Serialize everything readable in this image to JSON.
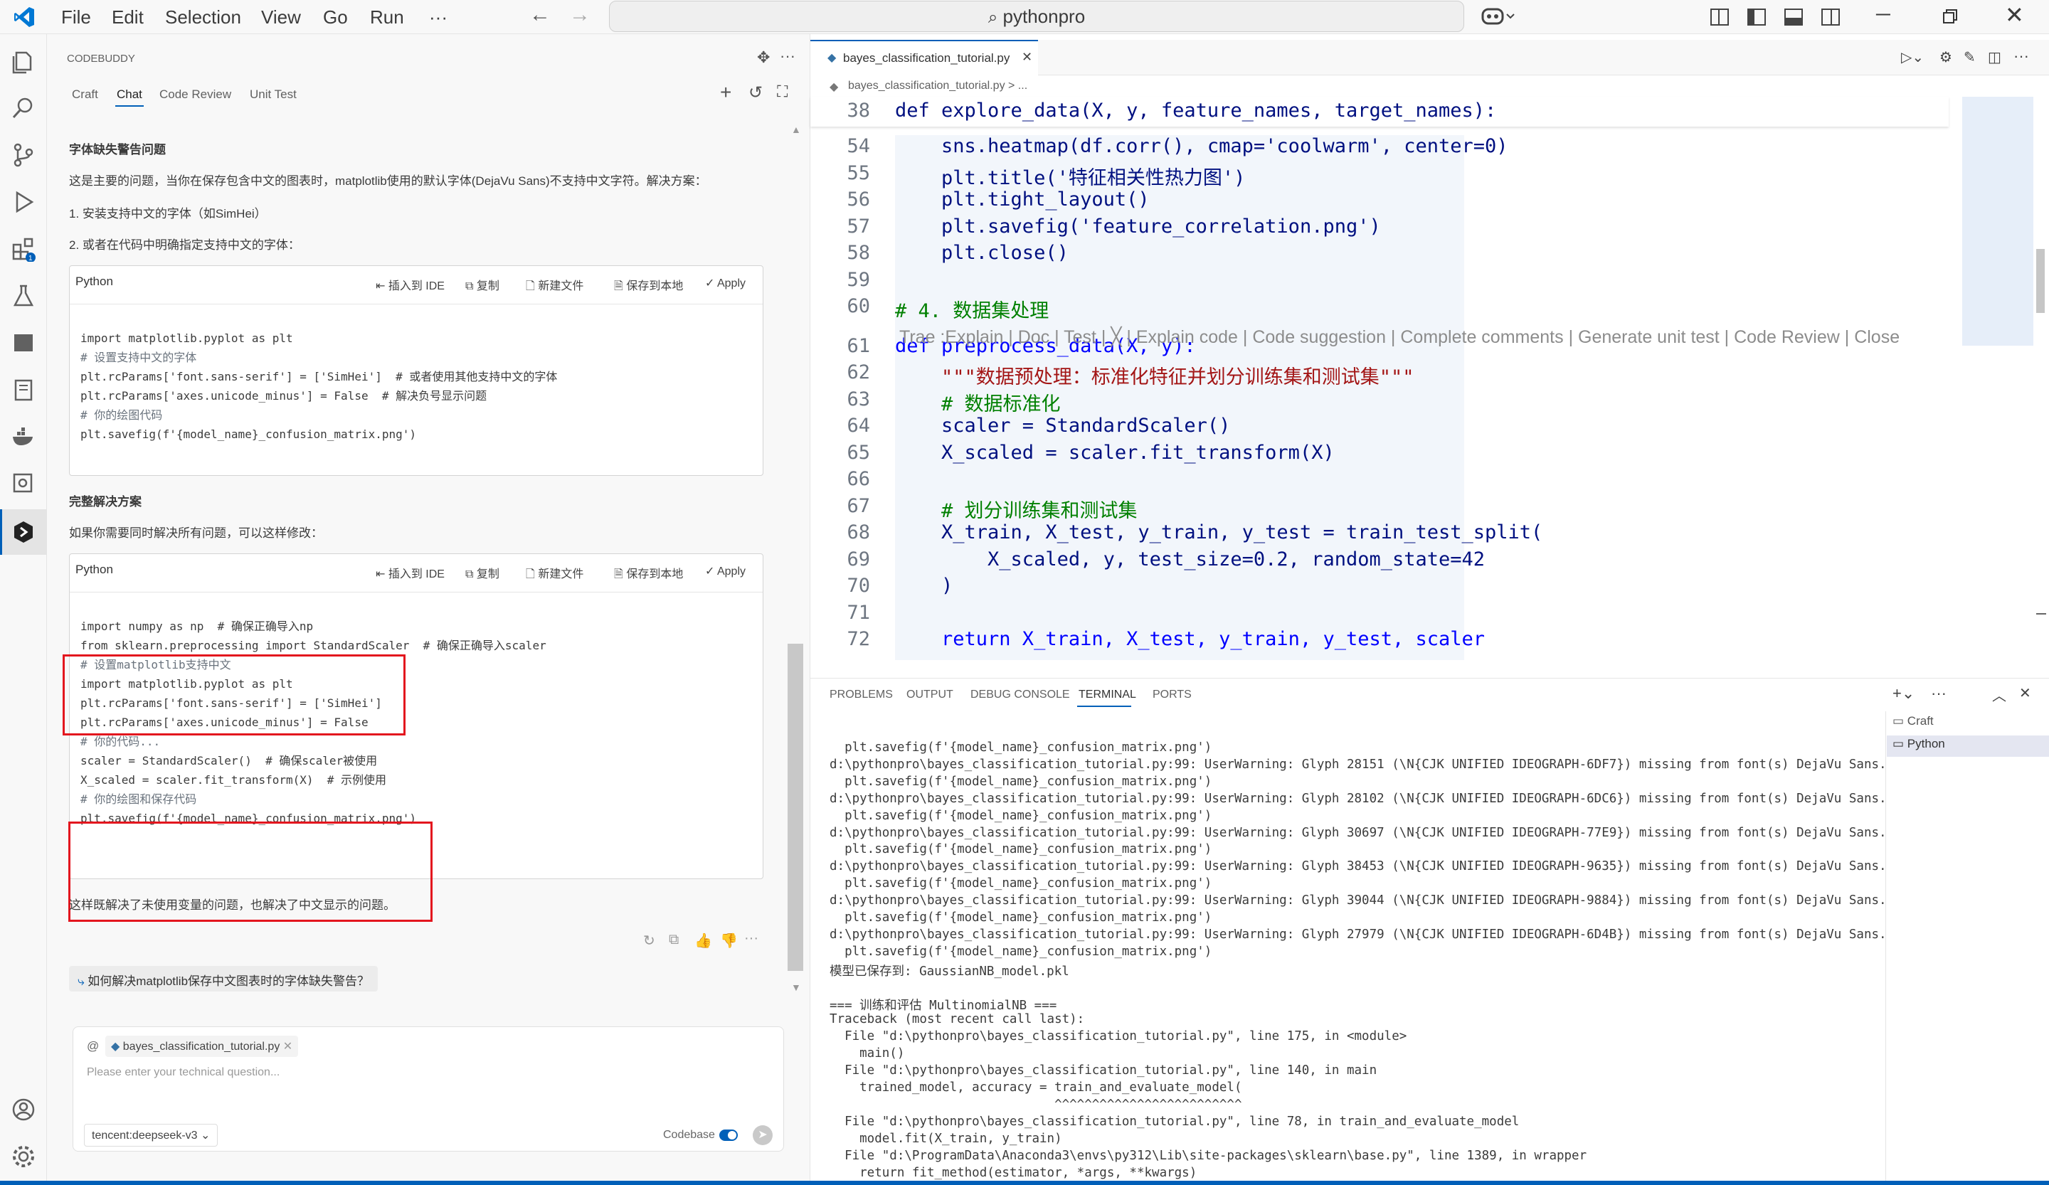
{
  "menu": [
    "File",
    "Edit",
    "Selection",
    "View",
    "Go",
    "Run",
    "···"
  ],
  "search": {
    "text": "pythonpro"
  },
  "codebuddy": {
    "title": "CODEBUDDY",
    "tabs": [
      "Craft",
      "Chat",
      "Code Review",
      "Unit Test"
    ],
    "section1_title": "字体缺失警告问题",
    "section1_desc": "这是主要的问题，当你在保存包含中文的图表时，matplotlib使用的默认字体(DejaVu Sans)不支持中文字符。解决方案：",
    "step1": "1. 安装支持中文的字体（如SimHei）",
    "step2": "2. 或者在代码中明确指定支持中文的字体：",
    "code_lang": "Python",
    "code_actions": [
      "插入到 IDE",
      "复制",
      "新建文件",
      "保存到本地",
      "Apply"
    ],
    "section2_title": "完整解决方案",
    "section2_desc": "如果你需要同时解决所有问题，可以这样修改：",
    "final_text": "这样既解决了未使用变量的问题，也解决了中文显示的问题。",
    "suggestion": "如何解决matplotlib保存中文图表时的字体缺失警告？",
    "input_file_chip": "bayes_classification_tutorial.py",
    "input_placeholder": "Please enter your technical question...",
    "model": "tencent:deepseek-v3",
    "codebase_label": "Codebase",
    "at": "@",
    "code1": [
      "import matplotlib.pyplot as plt",
      "",
      "# 设置支持中文的字体",
      "plt.rcParams['font.sans-serif'] = ['SimHei']  # 或者使用其他支持中文的字体",
      "plt.rcParams['axes.unicode_minus'] = False  # 解决负号显示问题",
      "",
      "# 你的绘图代码",
      "plt.savefig(f'{model_name}_confusion_matrix.png')"
    ],
    "code2": [
      "import numpy as np  # 确保正确导入np",
      "from sklearn.preprocessing import StandardScaler  # 确保正确导入scaler",
      "",
      "# 设置matplotlib支持中文",
      "import matplotlib.pyplot as plt",
      "plt.rcParams['font.sans-serif'] = ['SimHei']",
      "plt.rcParams['axes.unicode_minus'] = False",
      "",
      "# 你的代码...",
      "scaler = StandardScaler()  # 确保scaler被使用",
      "X_scaled = scaler.fit_transform(X)  # 示例使用",
      "",
      "# 你的绘图和保存代码",
      "plt.savefig(f'{model_name}_confusion_matrix.png')"
    ]
  },
  "editor": {
    "tab": "bayes_classification_tutorial.py",
    "breadcrumb": "bayes_classification_tutorial.py > ...",
    "sticky_line": "38",
    "sticky_code": "def explore_data(X, y, feature_names, target_names):",
    "codelens": "Trae :Explain | Doc | Test | ╳ | Explain code | Code suggestion | Complete comments | Generate unit test | Code Review | Close",
    "lines": [
      {
        "n": "54",
        "t": "    sns.heatmap(df.corr(), cmap='coolwarm', center=0)"
      },
      {
        "n": "55",
        "t": "    plt.title('特征相关性热力图')"
      },
      {
        "n": "56",
        "t": "    plt.tight_layout()"
      },
      {
        "n": "57",
        "t": "    plt.savefig('feature_correlation.png')"
      },
      {
        "n": "58",
        "t": "    plt.close()"
      },
      {
        "n": "59",
        "t": ""
      },
      {
        "n": "60",
        "t": "# 4. 数据集处理"
      },
      {
        "n": "61",
        "t": "def preprocess_data(X, y):"
      },
      {
        "n": "62",
        "t": "    \"\"\"数据预处理：标准化特征并划分训练集和测试集\"\"\""
      },
      {
        "n": "63",
        "t": "    # 数据标准化"
      },
      {
        "n": "64",
        "t": "    scaler = StandardScaler()"
      },
      {
        "n": "65",
        "t": "    X_scaled = scaler.fit_transform(X)"
      },
      {
        "n": "66",
        "t": ""
      },
      {
        "n": "67",
        "t": "    # 划分训练集和测试集"
      },
      {
        "n": "68",
        "t": "    X_train, X_test, y_train, y_test = train_test_split("
      },
      {
        "n": "69",
        "t": "        X_scaled, y, test_size=0.2, random_state=42"
      },
      {
        "n": "70",
        "t": "    )"
      },
      {
        "n": "71",
        "t": ""
      },
      {
        "n": "72",
        "t": "    return X_train, X_test, y_train, y_test, scaler"
      }
    ]
  },
  "panel": {
    "tabs": [
      "PROBLEMS",
      "OUTPUT",
      "DEBUG CONSOLE",
      "TERMINAL",
      "PORTS"
    ],
    "terminals": [
      "Craft",
      "Python"
    ],
    "lines": [
      "  plt.savefig(f'{model_name}_confusion_matrix.png')",
      "d:\\pythonpro\\bayes_classification_tutorial.py:99: UserWarning: Glyph 28151 (\\N{CJK UNIFIED IDEOGRAPH-6DF7}) missing from font(s) DejaVu Sans.",
      "  plt.savefig(f'{model_name}_confusion_matrix.png')",
      "d:\\pythonpro\\bayes_classification_tutorial.py:99: UserWarning: Glyph 28102 (\\N{CJK UNIFIED IDEOGRAPH-6DC6}) missing from font(s) DejaVu Sans.",
      "  plt.savefig(f'{model_name}_confusion_matrix.png')",
      "d:\\pythonpro\\bayes_classification_tutorial.py:99: UserWarning: Glyph 30697 (\\N{CJK UNIFIED IDEOGRAPH-77E9}) missing from font(s) DejaVu Sans.",
      "  plt.savefig(f'{model_name}_confusion_matrix.png')",
      "d:\\pythonpro\\bayes_classification_tutorial.py:99: UserWarning: Glyph 38453 (\\N{CJK UNIFIED IDEOGRAPH-9635}) missing from font(s) DejaVu Sans.",
      "  plt.savefig(f'{model_name}_confusion_matrix.png')",
      "d:\\pythonpro\\bayes_classification_tutorial.py:99: UserWarning: Glyph 39044 (\\N{CJK UNIFIED IDEOGRAPH-9884}) missing from font(s) DejaVu Sans.",
      "  plt.savefig(f'{model_name}_confusion_matrix.png')",
      "d:\\pythonpro\\bayes_classification_tutorial.py:99: UserWarning: Glyph 27979 (\\N{CJK UNIFIED IDEOGRAPH-6D4B}) missing from font(s) DejaVu Sans.",
      "  plt.savefig(f'{model_name}_confusion_matrix.png')",
      "模型已保存到: GaussianNB_model.pkl",
      "",
      "=== 训练和评估 MultinomialNB ===",
      "Traceback (most recent call last):",
      "  File \"d:\\pythonpro\\bayes_classification_tutorial.py\", line 175, in <module>",
      "    main()",
      "  File \"d:\\pythonpro\\bayes_classification_tutorial.py\", line 140, in main",
      "    trained_model, accuracy = train_and_evaluate_model(",
      "                              ^^^^^^^^^^^^^^^^^^^^^^^^^",
      "  File \"d:\\pythonpro\\bayes_classification_tutorial.py\", line 78, in train_and_evaluate_model",
      "    model.fit(X_train, y_train)",
      "  File \"d:\\ProgramData\\Anaconda3\\envs\\py312\\Lib\\site-packages\\sklearn\\base.py\", line 1389, in wrapper",
      "    return fit_method(estimator, *args, **kwargs)"
    ]
  },
  "colors": {
    "accent": "#005fb8",
    "highlight": "#e3161e"
  }
}
